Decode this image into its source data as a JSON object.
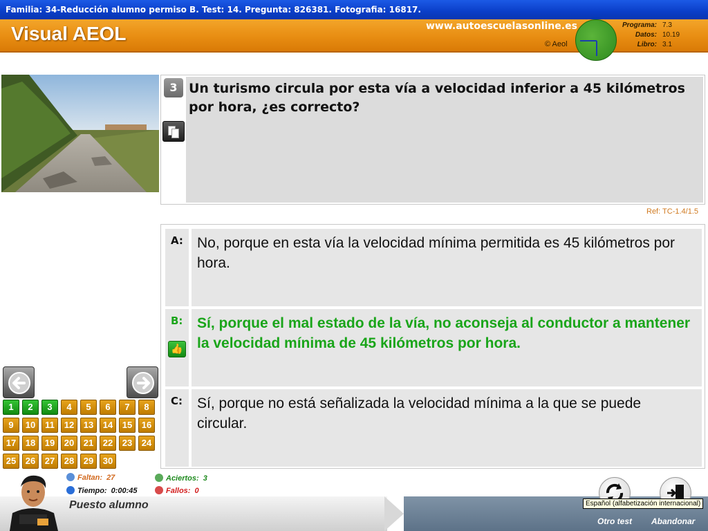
{
  "window": {
    "title": "Familia: 34-Reducción alumno permiso B. Test: 14. Pregunta: 826381. Fotografia: 16817."
  },
  "header": {
    "app_name": "Visual AEOL",
    "site": "www.autoescuelasonline.es",
    "copyright": "© Aeol",
    "versions": [
      {
        "label": "Programa:",
        "value": "7.3"
      },
      {
        "label": "Datos:",
        "value": "10.19"
      },
      {
        "label": "Libro:",
        "value": "3.1"
      }
    ]
  },
  "question": {
    "number": "3",
    "text": "Un turismo circula por esta vía a velocidad inferior a 45 kilómetros por hora, ¿es correcto?",
    "ref": "Ref: TC-1.4/1.5"
  },
  "answers": [
    {
      "letter": "A:",
      "text": "No, porque en esta vía la velocidad mínima permitida es 45 kilómetros por hora."
    },
    {
      "letter": "B:",
      "text": "Sí, porque el mal estado de la vía, no aconseja al conductor a mantener la velocidad mínima de 45 kilómetros por hora."
    },
    {
      "letter": "C:",
      "text": "Sí, porque no está señalizada la velocidad mínima a la que se puede circular."
    }
  ],
  "question_grid": [
    "1",
    "2",
    "3",
    "4",
    "5",
    "6",
    "7",
    "8",
    "9",
    "10",
    "11",
    "12",
    "13",
    "14",
    "15",
    "16",
    "17",
    "18",
    "19",
    "20",
    "21",
    "22",
    "23",
    "24",
    "25",
    "26",
    "27",
    "28",
    "29",
    "30"
  ],
  "stats": {
    "faltan_label": "Faltan:",
    "faltan_value": "27",
    "tiempo_label": "Tiempo:",
    "tiempo_value": "0:00:45",
    "aciertos_label": "Aciertos:",
    "aciertos_value": "3",
    "fallos_label": "Fallos:",
    "fallos_value": "0"
  },
  "footer": {
    "title": "Puesto alumno",
    "otro_test": "Otro test",
    "abandonar": "Abandonar",
    "tooltip": "Español (alfabetización internacional)"
  },
  "colors": {
    "accent_orange": "#e88d12",
    "correct_green": "#1aa51a",
    "title_blue": "#0a3ec8"
  },
  "icons": {
    "copy": "copy-icon",
    "thumb": "thumbs-up-icon",
    "prev": "arrow-left-icon",
    "next": "arrow-right-icon",
    "retry": "refresh-icon",
    "exit": "exit-door-icon"
  }
}
